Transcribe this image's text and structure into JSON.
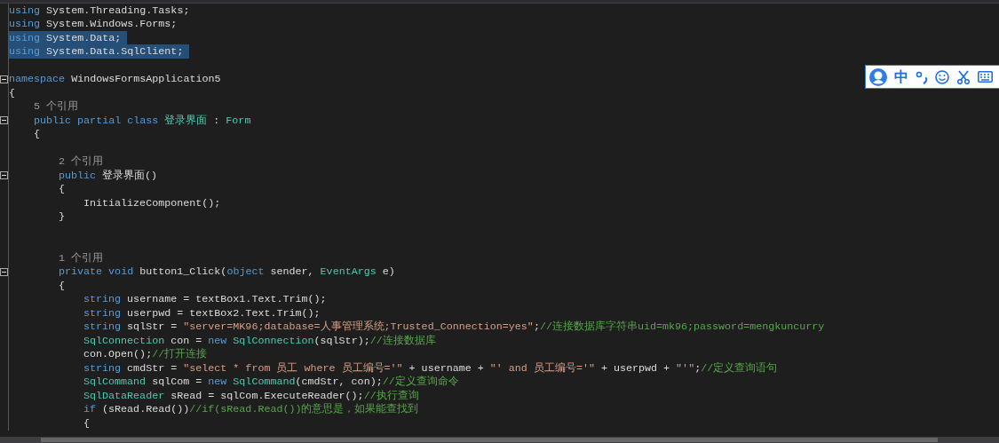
{
  "lines": [
    {
      "kind": "code",
      "selected": false,
      "tokens": [
        {
          "kind": "kw",
          "t": "using"
        },
        {
          "kind": "plain",
          "t": " System.Threading.Tasks;"
        }
      ]
    },
    {
      "kind": "code",
      "selected": false,
      "tokens": [
        {
          "kind": "kw",
          "t": "using"
        },
        {
          "kind": "plain",
          "t": " System.Windows.Forms;"
        }
      ]
    },
    {
      "kind": "code",
      "selected": true,
      "tokens": [
        {
          "kind": "kw",
          "t": "using"
        },
        {
          "kind": "plain",
          "t": " System.Data;"
        }
      ]
    },
    {
      "kind": "code",
      "selected": true,
      "tokens": [
        {
          "kind": "kw",
          "t": "using"
        },
        {
          "kind": "plain",
          "t": " System.Data.SqlClient;"
        }
      ]
    },
    {
      "kind": "blank"
    },
    {
      "kind": "code",
      "selected": false,
      "folded": false,
      "tokens": [
        {
          "kind": "kw",
          "t": "namespace"
        },
        {
          "kind": "plain",
          "t": " WindowsFormsApplication5"
        }
      ]
    },
    {
      "kind": "code",
      "selected": false,
      "tokens": [
        {
          "kind": "plain",
          "t": "{"
        }
      ]
    },
    {
      "kind": "block",
      "children": [
        {
          "kind": "lens",
          "text": "5 个引用"
        },
        {
          "kind": "code",
          "selected": false,
          "folded": false,
          "tokens": [
            {
              "kind": "kw",
              "t": "public partial class "
            },
            {
              "kind": "type",
              "t": "登录界面"
            },
            {
              "kind": "plain",
              "t": " : "
            },
            {
              "kind": "type",
              "t": "Form"
            }
          ]
        },
        {
          "kind": "code",
          "selected": false,
          "tokens": [
            {
              "kind": "plain",
              "t": "{"
            }
          ]
        },
        {
          "kind": "block",
          "children": [
            {
              "kind": "blank"
            },
            {
              "kind": "lens",
              "text": "2 个引用"
            },
            {
              "kind": "code",
              "selected": false,
              "folded": false,
              "tokens": [
                {
                  "kind": "kw",
                  "t": "public"
                },
                {
                  "kind": "plain",
                  "t": " 登录界面()"
                }
              ]
            },
            {
              "kind": "code",
              "selected": false,
              "tokens": [
                {
                  "kind": "plain",
                  "t": "{"
                }
              ]
            },
            {
              "kind": "block",
              "children": [
                {
                  "kind": "code",
                  "selected": false,
                  "tokens": [
                    {
                      "kind": "plain",
                      "t": "InitializeComponent();"
                    }
                  ]
                }
              ]
            },
            {
              "kind": "code",
              "selected": false,
              "tokens": [
                {
                  "kind": "plain",
                  "t": "}"
                }
              ]
            },
            {
              "kind": "blank"
            },
            {
              "kind": "blank"
            },
            {
              "kind": "lens",
              "text": "1 个引用"
            },
            {
              "kind": "code",
              "selected": false,
              "folded": false,
              "tokens": [
                {
                  "kind": "kw",
                  "t": "private void"
                },
                {
                  "kind": "plain",
                  "t": " button1_Click("
                },
                {
                  "kind": "kw",
                  "t": "object"
                },
                {
                  "kind": "plain",
                  "t": " sender, "
                },
                {
                  "kind": "type",
                  "t": "EventArgs"
                },
                {
                  "kind": "plain",
                  "t": " e)"
                }
              ]
            },
            {
              "kind": "code",
              "selected": false,
              "tokens": [
                {
                  "kind": "plain",
                  "t": "{"
                }
              ]
            },
            {
              "kind": "block",
              "children": [
                {
                  "kind": "code",
                  "selected": false,
                  "tokens": [
                    {
                      "kind": "kw",
                      "t": "string"
                    },
                    {
                      "kind": "plain",
                      "t": " username = textBox1.Text.Trim();"
                    }
                  ]
                },
                {
                  "kind": "code",
                  "selected": false,
                  "tokens": [
                    {
                      "kind": "kw",
                      "t": "string"
                    },
                    {
                      "kind": "plain",
                      "t": " userpwd = textBox2.Text.Trim();"
                    }
                  ]
                },
                {
                  "kind": "code",
                  "selected": false,
                  "tokens": [
                    {
                      "kind": "kw",
                      "t": "string"
                    },
                    {
                      "kind": "plain",
                      "t": " sqlStr = "
                    },
                    {
                      "kind": "str",
                      "t": "\"server=MK96;database=人事管理系统;Trusted_Connection=yes\""
                    },
                    {
                      "kind": "plain",
                      "t": ";"
                    },
                    {
                      "kind": "comment",
                      "t": "//连接数据库字符串uid=mk96;password=mengkuncurry"
                    }
                  ]
                },
                {
                  "kind": "code",
                  "selected": false,
                  "tokens": [
                    {
                      "kind": "type",
                      "t": "SqlConnection"
                    },
                    {
                      "kind": "plain",
                      "t": " con = "
                    },
                    {
                      "kind": "kw",
                      "t": "new "
                    },
                    {
                      "kind": "type",
                      "t": "SqlConnection"
                    },
                    {
                      "kind": "plain",
                      "t": "(sqlStr);"
                    },
                    {
                      "kind": "comment",
                      "t": "//连接数据库"
                    }
                  ]
                },
                {
                  "kind": "code",
                  "selected": false,
                  "tokens": [
                    {
                      "kind": "plain",
                      "t": "con.Open();"
                    },
                    {
                      "kind": "comment",
                      "t": "//打开连接"
                    }
                  ]
                },
                {
                  "kind": "code",
                  "selected": false,
                  "tokens": [
                    {
                      "kind": "kw",
                      "t": "string"
                    },
                    {
                      "kind": "plain",
                      "t": " cmdStr = "
                    },
                    {
                      "kind": "str",
                      "t": "\"select * from 员工 where 员工编号='\""
                    },
                    {
                      "kind": "plain",
                      "t": " + username + "
                    },
                    {
                      "kind": "str",
                      "t": "\"' and 员工编号='\""
                    },
                    {
                      "kind": "plain",
                      "t": " + userpwd + "
                    },
                    {
                      "kind": "str",
                      "t": "\"'\""
                    },
                    {
                      "kind": "plain",
                      "t": ";"
                    },
                    {
                      "kind": "comment",
                      "t": "//定义查询语句"
                    }
                  ]
                },
                {
                  "kind": "code",
                  "selected": false,
                  "tokens": [
                    {
                      "kind": "type",
                      "t": "SqlCommand"
                    },
                    {
                      "kind": "plain",
                      "t": " sqlCom = "
                    },
                    {
                      "kind": "kw",
                      "t": "new "
                    },
                    {
                      "kind": "type",
                      "t": "SqlCommand"
                    },
                    {
                      "kind": "plain",
                      "t": "(cmdStr, con);"
                    },
                    {
                      "kind": "comment",
                      "t": "//定义查询命令"
                    }
                  ]
                },
                {
                  "kind": "code",
                  "selected": false,
                  "tokens": [
                    {
                      "kind": "type",
                      "t": "SqlDataReader"
                    },
                    {
                      "kind": "plain",
                      "t": " sRead = sqlCom.ExecuteReader();"
                    },
                    {
                      "kind": "comment",
                      "t": "//执行查询"
                    }
                  ]
                },
                {
                  "kind": "code",
                  "selected": false,
                  "tokens": [
                    {
                      "kind": "kw",
                      "t": "if"
                    },
                    {
                      "kind": "plain",
                      "t": " (sRead.Read())"
                    },
                    {
                      "kind": "comment",
                      "t": "//if(sRead.Read())的意思是，如果能查找到"
                    }
                  ]
                },
                {
                  "kind": "code",
                  "selected": false,
                  "tokens": [
                    {
                      "kind": "plain",
                      "t": "{"
                    }
                  ]
                }
              ]
            }
          ]
        }
      ]
    }
  ],
  "ime_toolbar": {
    "mode": "中"
  }
}
